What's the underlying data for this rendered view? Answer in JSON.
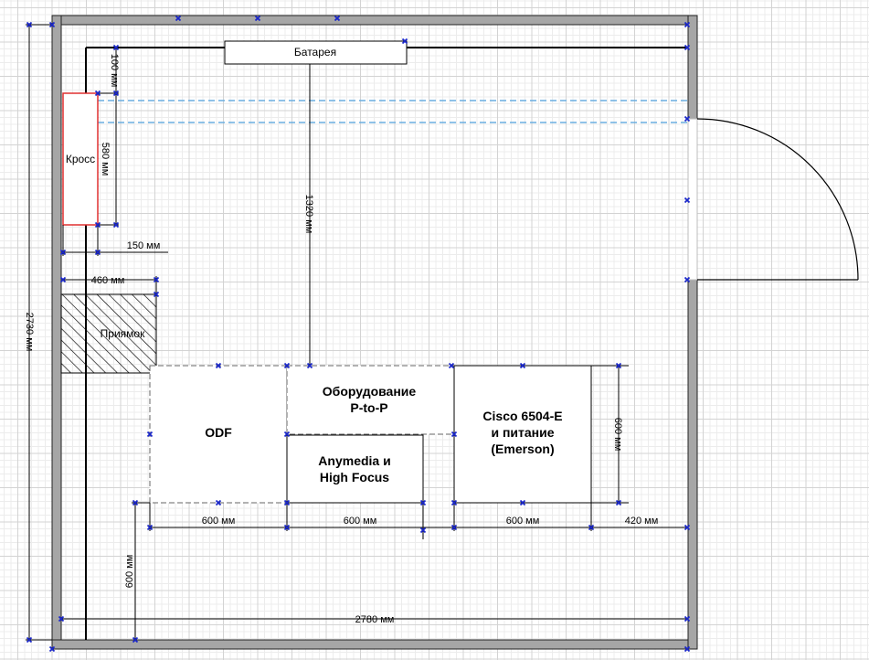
{
  "objects": {
    "battery": "Батарея",
    "cross": "Кросс",
    "pit": "Приямок",
    "odf": "ODF",
    "ptp_line1": "Оборудование",
    "ptp_line2": "P-to-P",
    "anymedia_line1": "Anymedia и",
    "anymedia_line2": "High Focus",
    "cisco_line1": "Cisco 6504-E",
    "cisco_line2": "и питание",
    "cisco_line3": "(Emerson)"
  },
  "dimensions": {
    "d100": "100 мм",
    "d580": "580 мм",
    "d1320": "1320 мм",
    "d150": "150 мм",
    "d460": "460 мм",
    "d2730": "2730 мм",
    "d600_odf": "600 мм",
    "d600_anymedia": "600 мм",
    "d600_cisco": "600 мм",
    "d420": "420 мм",
    "d600_depth": "600 мм",
    "d600_left": "600 мм",
    "d2780": "2780 мм"
  },
  "colors": {
    "wall": "#a6a6a6",
    "handle": "#1a27c9",
    "cross_border": "#e03030",
    "cable_tray": "#6aaee0"
  }
}
